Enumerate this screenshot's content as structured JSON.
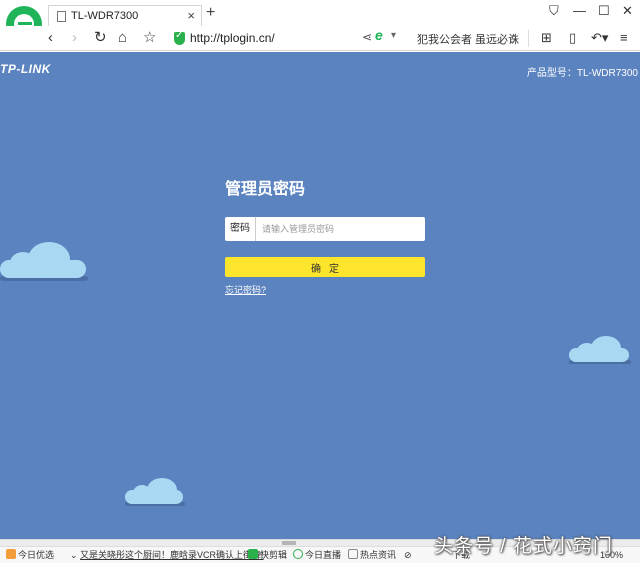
{
  "browser": {
    "tab_title": "TL-WDR7300",
    "url": "http://tplogin.cn/",
    "search_hint": "犯我公会者 虽远必诛"
  },
  "page": {
    "brand": "TP-LINK",
    "model_label": "产品型号：TL-WDR7300",
    "login_title": "管理员密码",
    "password_label": "密码",
    "password_placeholder": "请输入管理员密码",
    "password_value": "",
    "confirm_button": "确定",
    "forgot_link": "忘记密码?",
    "background_color": "#5b83c0",
    "button_color": "#fde52b",
    "cloud_color": "#a9d9f2"
  },
  "statusbar": {
    "items": [
      "今日优选",
      "又是关晓彤这个厨间！鹿晗录VCR确认上街舞!",
      "快剪辑",
      "今日直播",
      "热点资讯",
      "下载"
    ],
    "zoom": "100%"
  },
  "watermark": "头条号 / 花式小窍门"
}
